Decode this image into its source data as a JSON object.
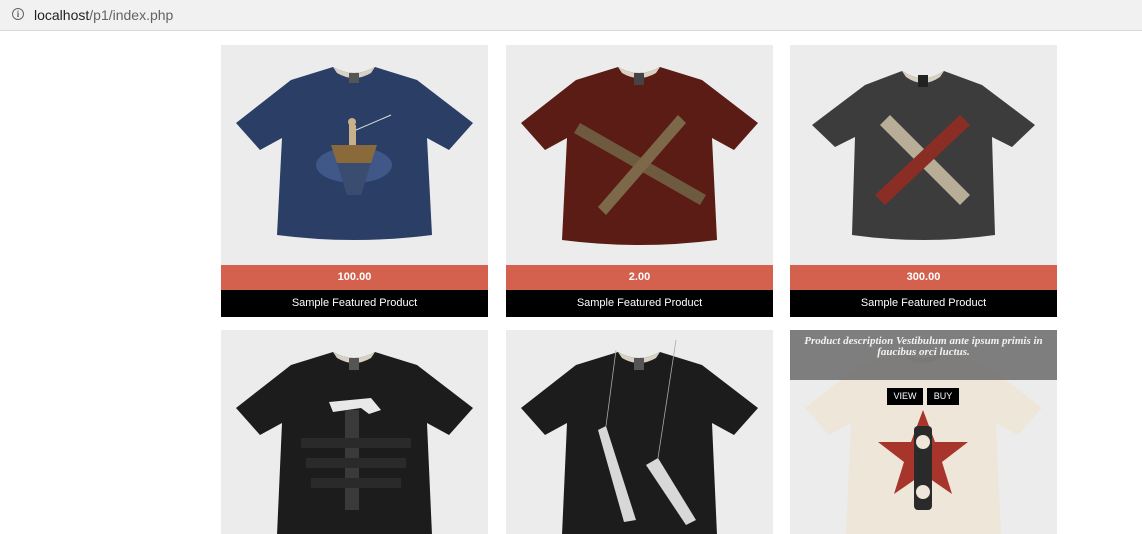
{
  "browser": {
    "url_host": "localhost",
    "url_path": "/p1/index.php",
    "info_icon": "info-icon"
  },
  "products": [
    {
      "price": "100.00",
      "title": "Sample Featured Product",
      "shirt_color": "#2b3e66",
      "design": "boat-fisherman"
    },
    {
      "price": "2.00",
      "title": "Sample Featured Product",
      "shirt_color": "#5a1c14",
      "design": "wooden-cross"
    },
    {
      "price": "300.00",
      "title": "Sample Featured Product",
      "shirt_color": "#3c3c3c",
      "design": "crossed-logs"
    },
    {
      "design": "hammer-taped",
      "shirt_color": "#1c1c1c"
    },
    {
      "design": "reaching-hands",
      "shirt_color": "#1c1c1c"
    },
    {
      "design": "star-cassette",
      "shirt_color": "#ede6d9",
      "overlay_text": "Product description Vestibulum ante ipsum primis in faucibus orci luctus.",
      "view_label": "VIEW",
      "buy_label": "BUY"
    }
  ],
  "colors": {
    "price_bar": "#d4614e",
    "title_bar": "#000000",
    "card_bg": "#ececec"
  }
}
